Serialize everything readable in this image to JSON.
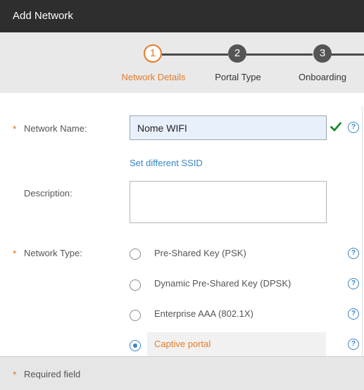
{
  "window": {
    "title": "Add Network"
  },
  "stepper": {
    "steps": [
      {
        "number": "1",
        "label": "Network Details",
        "state": "active"
      },
      {
        "number": "2",
        "label": "Portal Type",
        "state": "inactive"
      },
      {
        "number": "3",
        "label": "Onboarding",
        "state": "inactive"
      }
    ]
  },
  "form": {
    "required_mark": "*",
    "network_name": {
      "label": "Network Name:",
      "value": "Nome WIFI",
      "help": "?"
    },
    "set_ssid_link": "Set different SSID",
    "description": {
      "label": "Description:",
      "value": ""
    },
    "network_type": {
      "label": "Network Type:",
      "options": [
        {
          "label": "Pre-Shared Key (PSK)",
          "selected": false,
          "help": "?"
        },
        {
          "label": "Dynamic Pre-Shared Key (DPSK)",
          "selected": false,
          "help": "?"
        },
        {
          "label": "Enterprise AAA (802.1X)",
          "selected": false,
          "help": "?"
        },
        {
          "label": "Captive portal",
          "selected": true,
          "help": "?"
        }
      ]
    }
  },
  "footer": {
    "required_mark": "*",
    "required_text": "Required field"
  },
  "colors": {
    "accent": "#e57b29",
    "link": "#3a85c6",
    "header_bg": "#2e2e2e",
    "check": "#1a8a2a"
  },
  "icons": {
    "valid": "check-icon",
    "help": "help-icon"
  }
}
